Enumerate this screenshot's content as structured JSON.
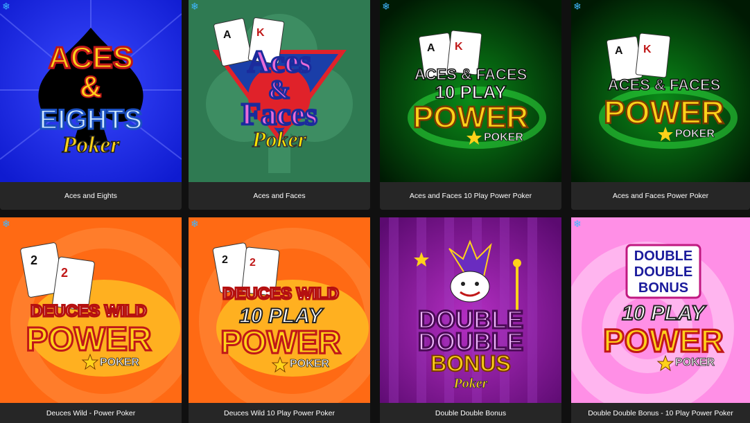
{
  "games": [
    {
      "title": "Aces and Eights",
      "favorite_icon": "snowflake-icon",
      "logo": {
        "line1": "ACES",
        "amp": "&",
        "line2": "EIGHTS",
        "line3": "Poker"
      }
    },
    {
      "title": "Aces and Faces",
      "favorite_icon": "snowflake-icon",
      "logo": {
        "line1": "Aces",
        "amp": "&",
        "line2": "Faces",
        "line3": "Poker"
      }
    },
    {
      "title": "Aces and Faces 10 Play Power Poker",
      "favorite_icon": "snowflake-icon",
      "logo": {
        "line1": "ACES & FACES",
        "line2": "10 PLAY",
        "line3": "POWER",
        "line4": "POKER"
      }
    },
    {
      "title": "Aces and Faces Power Poker",
      "favorite_icon": "snowflake-icon",
      "logo": {
        "line1": "ACES & FACES",
        "line3": "POWER",
        "line4": "POKER"
      }
    },
    {
      "title": "Deuces Wild - Power Poker",
      "favorite_icon": "snowflake-icon",
      "logo": {
        "line1": "DEUCES WILD",
        "line3": "POWER",
        "line4": "POKER"
      }
    },
    {
      "title": "Deuces Wild 10 Play Power Poker",
      "favorite_icon": "snowflake-icon",
      "logo": {
        "line1": "DEUCES WILD",
        "line2": "10 PLAY",
        "line3": "POWER",
        "line4": "POKER"
      }
    },
    {
      "title": "Double Double Bonus",
      "favorite_icon": "",
      "logo": {
        "line1": "DOUBLE",
        "line2": "DOUBLE",
        "line3": "BONUS",
        "line4": "Poker"
      }
    },
    {
      "title": "Double Double Bonus - 10 Play Power Poker",
      "favorite_icon": "snowflake-icon",
      "logo": {
        "line1": "DOUBLE",
        "line2": "DOUBLE",
        "line2b": "BONUS",
        "line3": "10 PLAY",
        "line4": "POWER",
        "line5": "POKER"
      }
    }
  ],
  "colors": {
    "background": "#101010",
    "caption_bg": "#262626",
    "snowflake": "#3fb7ff",
    "gold": "#ffd21a",
    "red": "#e0222a"
  }
}
